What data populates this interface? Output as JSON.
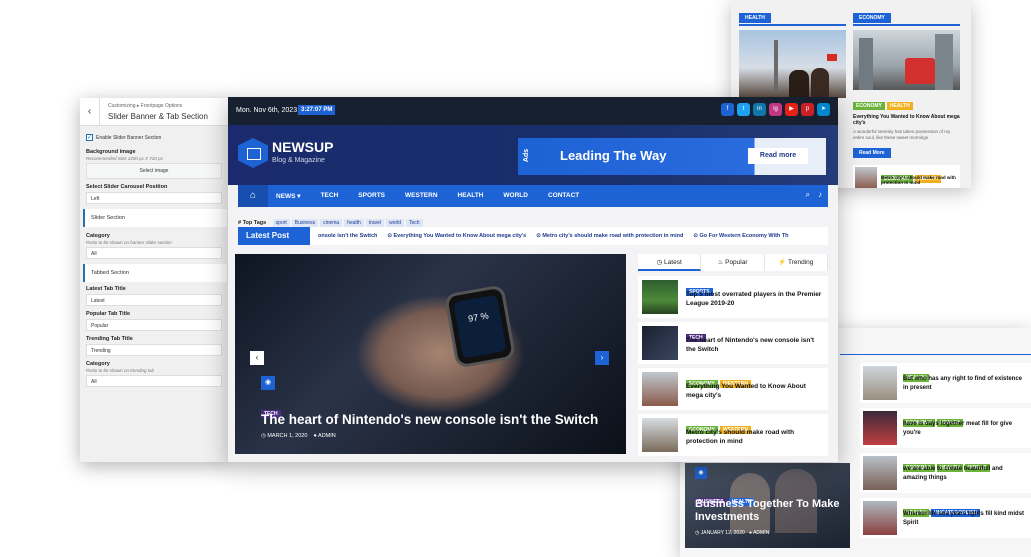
{
  "colors": {
    "accent": "#1e63d6",
    "dark": "#16202f",
    "green": "#6bb33b",
    "yellow": "#f2b01c"
  },
  "card_tr": {
    "col1_title": "HEALTH",
    "col2_title": "ECONOMY",
    "col2_tags": [
      "ECONOMY",
      "HEALTH"
    ],
    "col2_headline": "Everything You Wanted to Know About mega city's",
    "col2_excerpt": "A wonderful serenity has taken possession of my entire soul, like these sweet mornings",
    "read_more": "Read More",
    "small_tags": [
      "ECONOMY",
      "HEALTH"
    ],
    "small_headline": "Metro city's should make road with protection in mind"
  },
  "customizer": {
    "back_icon": "chevron-left-icon",
    "breadcrumb": "Customizing ▸ Frontpage Options",
    "title": "Slider Banner & Tab Section",
    "enable_label": "Enable Slider Banner Section",
    "bg_label": "Background image",
    "bg_desc": "Recommended Size 1200 px X 720 px",
    "select_image": "Select image",
    "carousel_label": "Select Slider Carousel Position",
    "carousel_value": "Left",
    "slider_section": "Slider Section",
    "category_label": "Category",
    "category_desc": "Posts to be shown on banner slider section",
    "category_value": "All",
    "tabbed_section": "Tabbed Section",
    "latest_label": "Latest Tab Title",
    "latest_value": "Latest",
    "popular_label": "Popular Tab Title",
    "popular_value": "Popular",
    "trending_label": "Trending Tab Title",
    "trending_value": "Trending",
    "category2_label": "Category",
    "category2_desc": "Posts to be shown on trending tab",
    "category2_value": "All"
  },
  "site": {
    "date": "Mon. Nov 6th, 2023",
    "time": "3:27:07 PM",
    "socials": [
      {
        "icon": "f",
        "color": "#1e63d6"
      },
      {
        "icon": "t",
        "color": "#1da1f2"
      },
      {
        "icon": "in",
        "color": "#0e76a8"
      },
      {
        "icon": "ig",
        "color": "#c13584"
      },
      {
        "icon": "▶",
        "color": "#e62117"
      },
      {
        "icon": "p",
        "color": "#cb2027"
      },
      {
        "icon": "➤",
        "color": "#0088cc"
      }
    ],
    "logo_title": "NEWSUP",
    "logo_sub": "Blog & Magazine",
    "ad_side": "Ads",
    "ad_text": "Leading The Way",
    "ad_button": "Read more",
    "nav": [
      "NEWS ▾",
      "TECH",
      "SPORTS",
      "WESTERN",
      "HEALTH",
      "WORLD",
      "CONTACT"
    ],
    "top_tags_label": "# Top Tags",
    "top_tags": [
      "sport",
      "Business",
      "cinema",
      "health",
      "travel",
      "world",
      "Tech"
    ],
    "ticker_label": "Latest Post",
    "ticker": [
      "onsole isn't the Switch",
      "Everything You Wanted to Know About mega city's",
      "Metro city's should make road with protection in mind",
      "Go For Western Economy With Th"
    ],
    "hero_tag": "TECH",
    "hero_title": "The heart of Nintendo's new console isn't the Switch",
    "hero_date": "MARCH 1, 2020",
    "hero_author": "ADMIN",
    "watch_value": "97 %",
    "tabs": [
      "Latest",
      "Popular",
      "Trending"
    ],
    "side_items": [
      {
        "tags": [
          "SPORTS"
        ],
        "tag_colors": [
          "blue"
        ],
        "title": "Top 5 most overrated players in the Premier League 2019-20"
      },
      {
        "tags": [
          "TECH"
        ],
        "tag_colors": [
          "purple"
        ],
        "title": "The heart of Nintendo's new console isn't the Switch"
      },
      {
        "tags": [
          "ECONOMY",
          "WESTERN"
        ],
        "tag_colors": [
          "green",
          "yellow"
        ],
        "title": "Everything You Wanted to Know About mega city's"
      },
      {
        "tags": [
          "ECONOMY",
          "WESTERN"
        ],
        "tag_colors": [
          "green",
          "yellow"
        ],
        "title": "Metro city's should make road with protection in mind"
      }
    ]
  },
  "card_br": {
    "hero_tags": [
      "BUSINESS",
      "HEALTH"
    ],
    "hero_title": "Business Together To Make Investments",
    "hero_date": "JANUARY 12, 2020",
    "hero_author": "ADMIN",
    "items": [
      {
        "tags": [
          "HEALTH"
        ],
        "tag_colors": [
          "green"
        ],
        "title": "But who has any right to find of existence in present"
      },
      {
        "tags": [
          "ECONOMY",
          "HEALTH"
        ],
        "tag_colors": [
          "green",
          "green"
        ],
        "title": "have is days together meat fill for give you're"
      },
      {
        "tags": [
          "ECONOMY",
          "HEALTH",
          "WORLD"
        ],
        "tag_colors": [
          "green",
          "green",
          "green"
        ],
        "title": "we are able to create beautifull and amazing things"
      },
      {
        "tags": [
          "HEALTH",
          "UNCATEGORIZED"
        ],
        "tag_colors": [
          "green",
          "blue"
        ],
        "title": "Wherein life sea years lights fill kind midst Spirit"
      }
    ]
  }
}
